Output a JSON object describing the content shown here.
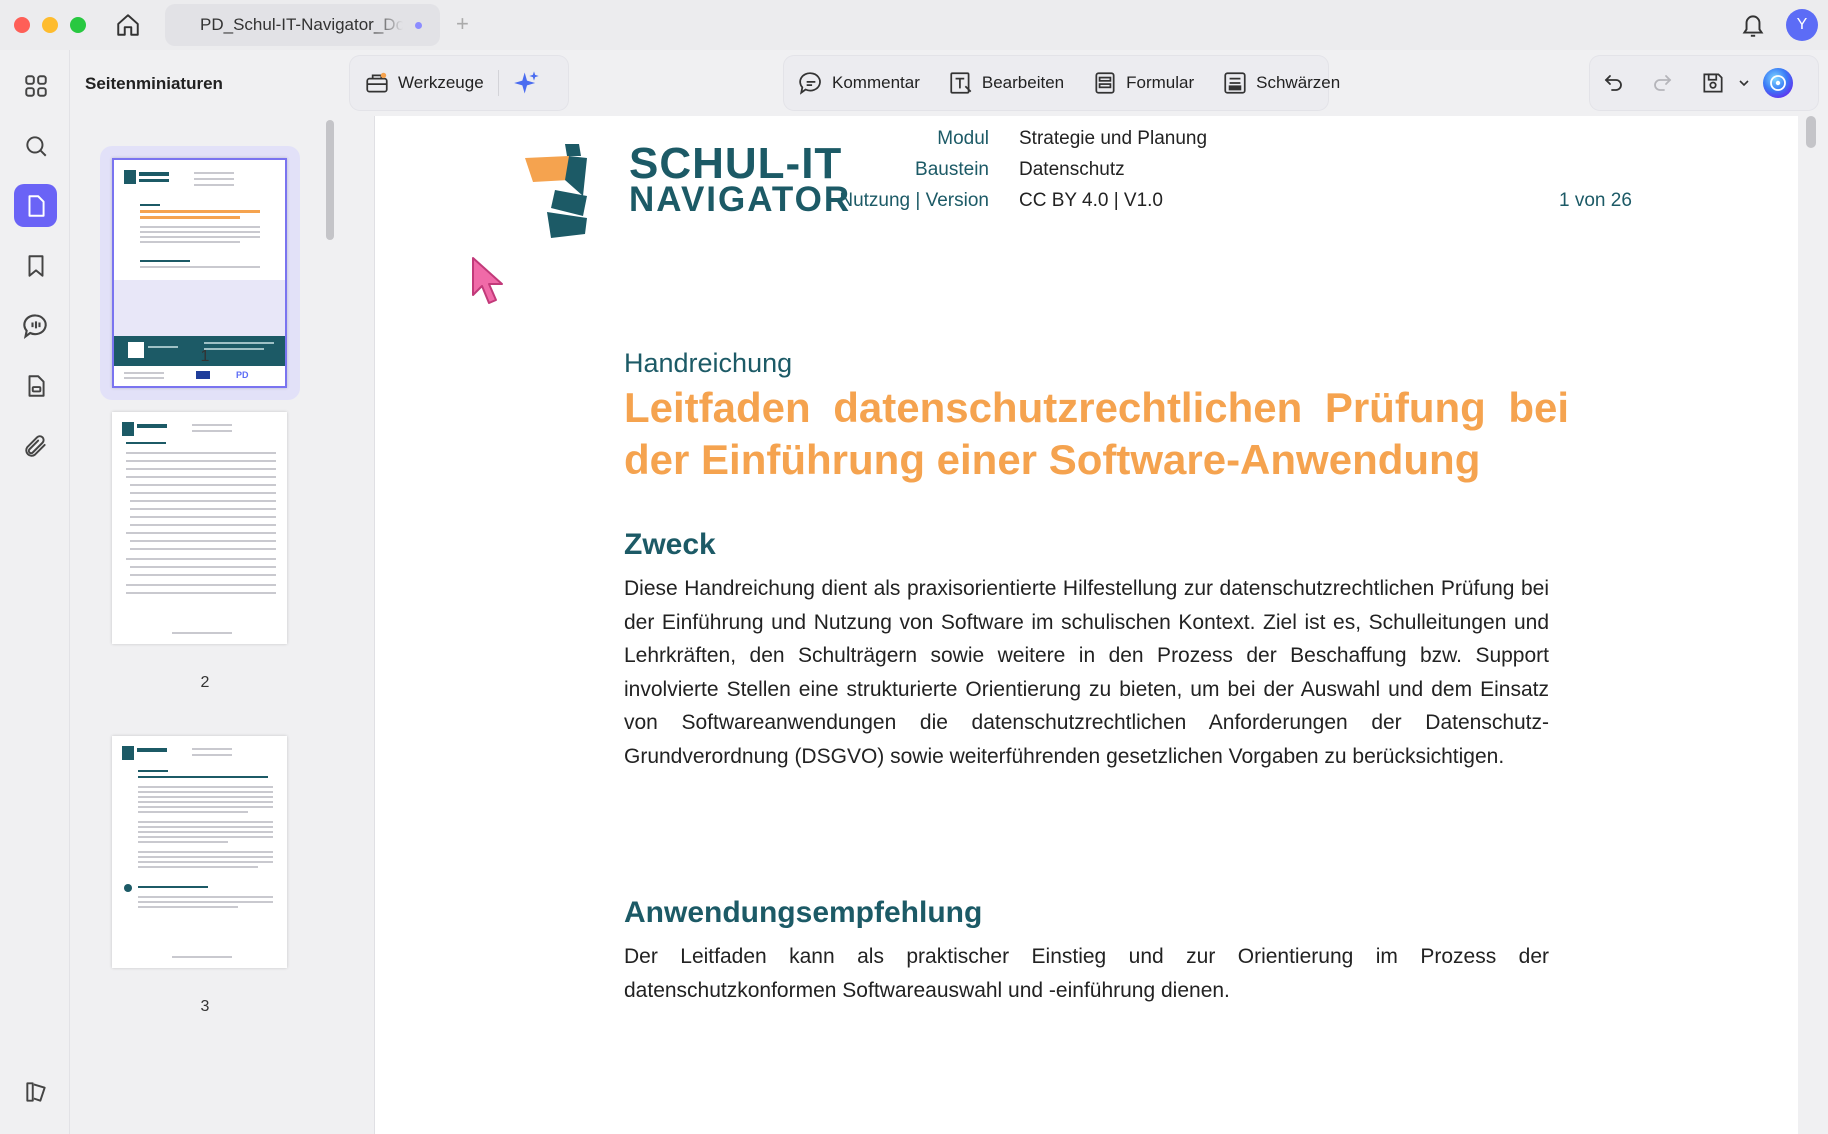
{
  "titlebar": {
    "tab_title": "PD_Schul-IT-Navigator_Do",
    "new_tab_icon": "+",
    "avatar_letter": "Y"
  },
  "sidebar": {
    "panel_title": "Seitenminiaturen",
    "thumbnails": [
      {
        "page": "1",
        "selected": true
      },
      {
        "page": "2",
        "selected": false
      },
      {
        "page": "3",
        "selected": false
      }
    ]
  },
  "toolbar": {
    "tools_label": "Werkzeuge",
    "comment_label": "Kommentar",
    "edit_label": "Bearbeiten",
    "form_label": "Formular",
    "redact_label": "Schwärzen"
  },
  "document": {
    "logo_line1": "SCHUL-IT",
    "logo_line2": "NAVIGATOR",
    "meta": [
      {
        "label": "Modul",
        "value": "Strategie und Planung"
      },
      {
        "label": "Baustein",
        "value": "Datenschutz"
      },
      {
        "label": "Nutzung | Version",
        "value": "CC BY 4.0 | V1.0"
      }
    ],
    "page_count": "1 von 26",
    "kicker": "Handreichung",
    "title": "Leitfaden datenschutzrechtlichen Prüfung bei der Einführung einer Software-Anwendung",
    "section1_heading": "Zweck",
    "section1_body": "Diese Handreichung dient als praxisorientierte Hilfestellung zur datenschutzrechtlichen Prüfung bei der Einführung und Nutzung von Software im schulischen Kontext. Ziel ist es, Schulleitungen und Lehrkräften, den Schulträgern sowie weitere in den Prozess der Beschaffung bzw. Support involvierte Stellen eine strukturierte Orientierung zu bieten, um bei der Auswahl und dem Einsatz von Softwareanwendungen die datenschutzrechtlichen Anforderungen der Datenschutz-Grundverordnung (DSGVO) sowie weiterführenden gesetzlichen Vorgaben zu berücksichtigen.",
    "section2_heading": "Anwendungsempfehlung",
    "section2_body": "Der Leitfaden kann als praktischer Einstieg und zur Orientierung im Prozess der datenschutzkonformen Softwareauswahl und -einführung dienen."
  },
  "colors": {
    "brand_teal": "#1c5a66",
    "brand_orange": "#f5a34f",
    "accent_purple": "#6a63f6"
  }
}
